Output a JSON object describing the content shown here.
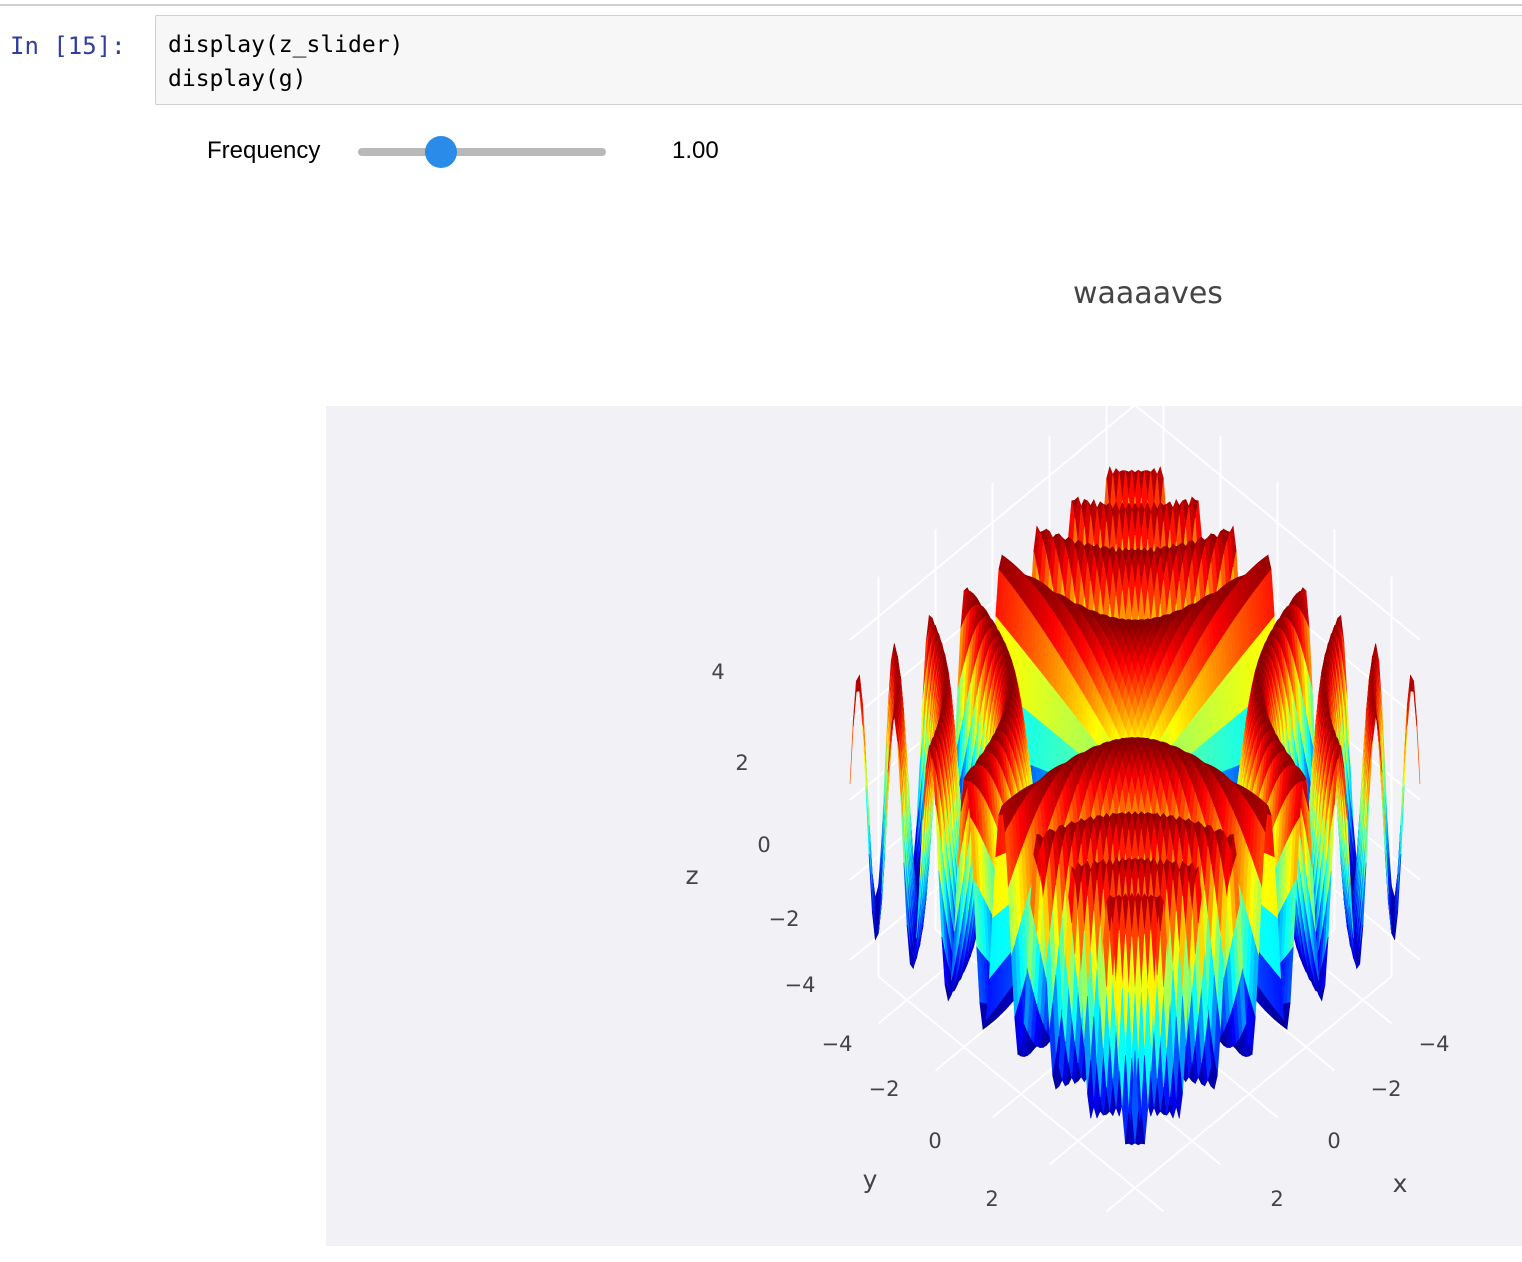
{
  "cell": {
    "prompt": "In [15]:",
    "code_lines": [
      "display(z_slider)",
      "display(g)"
    ]
  },
  "slider": {
    "label": "Frequency",
    "value_text": "1.00",
    "fraction": 0.34,
    "accent": "#2a8ce8"
  },
  "chart_data": {
    "type": "surface",
    "title": "waaaaves",
    "colorscale": "jet",
    "axes": {
      "x": {
        "title": "x",
        "ticks": [
          "−4",
          "−2",
          "0",
          "2"
        ]
      },
      "y": {
        "title": "y",
        "ticks": [
          "−4",
          "−2",
          "0",
          "2"
        ]
      },
      "z": {
        "title": "z",
        "ticks": [
          "4",
          "2",
          "0",
          "−2",
          "−4"
        ]
      }
    },
    "surface": {
      "function": "sin(frequency*x*y)",
      "frequency": 1.0,
      "xrange": [
        -5,
        5
      ],
      "yrange": [
        -5,
        5
      ]
    },
    "background": "#f1f1f6",
    "grid": true
  }
}
